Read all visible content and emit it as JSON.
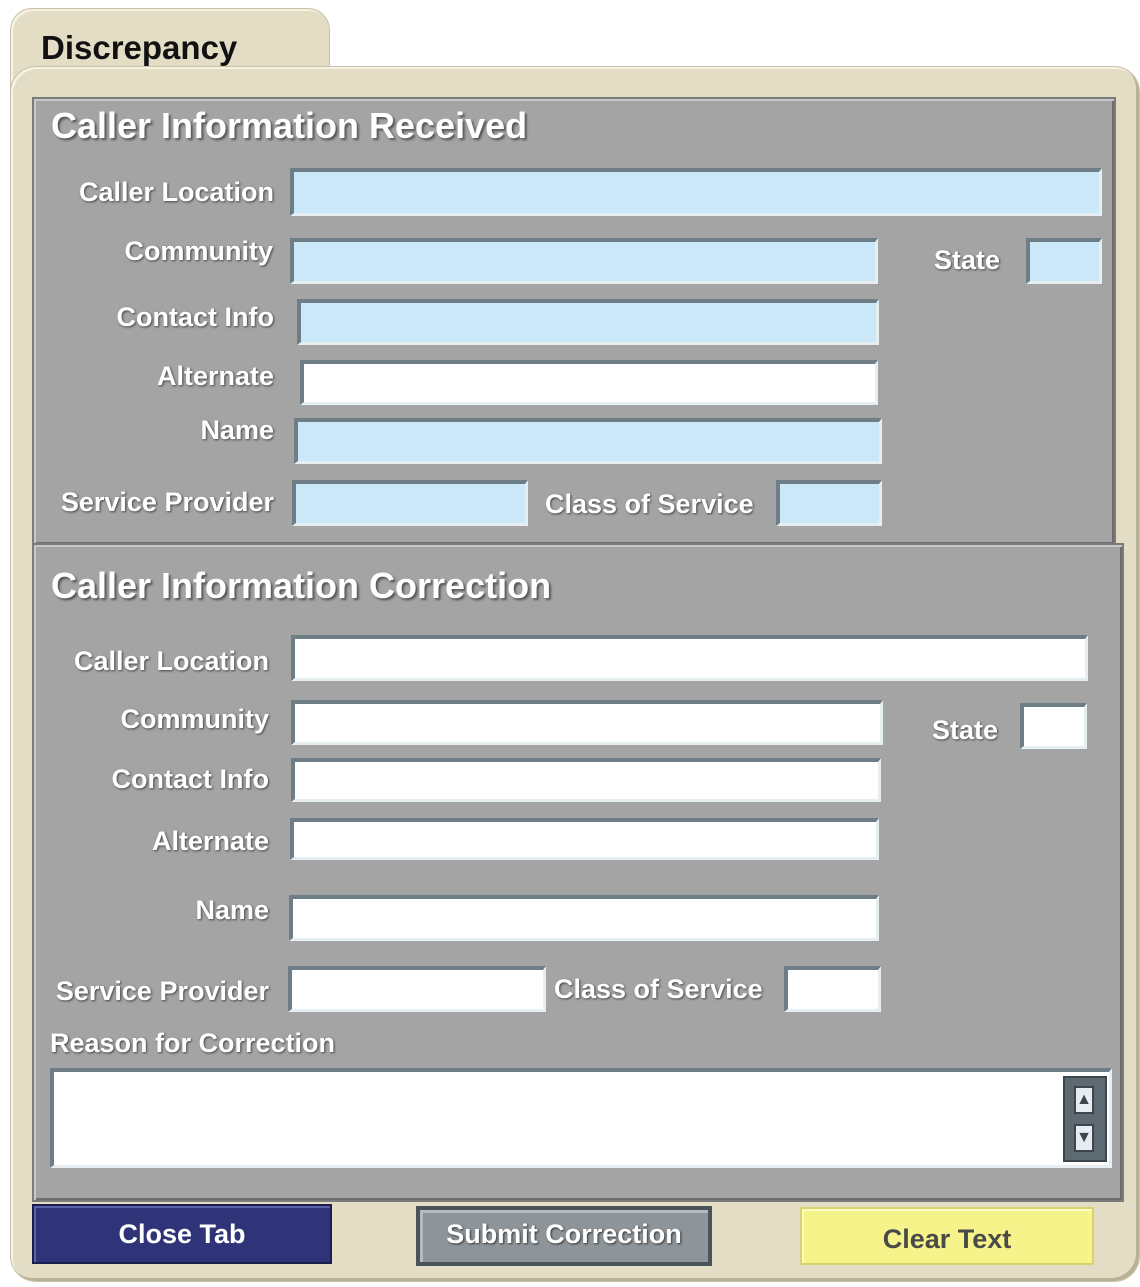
{
  "tab": {
    "title": "Discrepancy"
  },
  "received": {
    "title": "Caller Information Received",
    "caller_location_label": "Caller Location",
    "community_label": "Community",
    "state_label": "State",
    "contact_info_label": "Contact Info",
    "alternate_label": "Alternate",
    "name_label": "Name",
    "service_provider_label": "Service Provider",
    "class_of_service_label": "Class of Service"
  },
  "correction": {
    "title": "Caller Information Correction",
    "caller_location_label": "Caller Location",
    "community_label": "Community",
    "state_label": "State",
    "contact_info_label": "Contact Info",
    "alternate_label": "Alternate",
    "name_label": "Name",
    "service_provider_label": "Service Provider",
    "class_of_service_label": "Class of Service",
    "reason_label": "Reason for Correction"
  },
  "buttons": {
    "close": "Close Tab",
    "submit": "Submit Correction",
    "clear": "Clear Text"
  },
  "colors": {
    "panel": "#a4a4a4",
    "readonly_field": "#cbe8f8",
    "close_button": "#2e3477",
    "clear_button": "#f6f38a"
  }
}
